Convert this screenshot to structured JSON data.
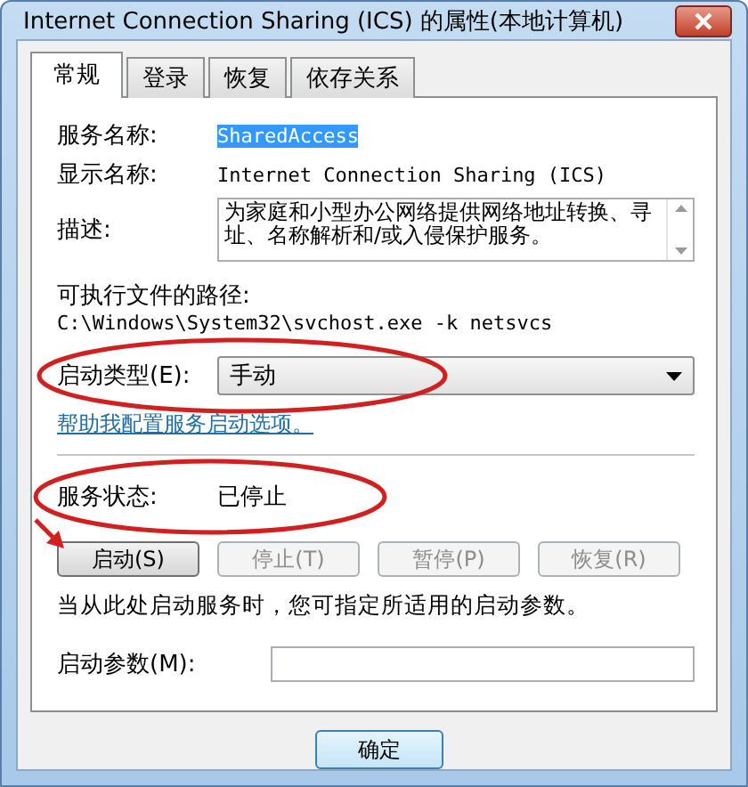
{
  "window": {
    "title": "Internet Connection Sharing (ICS) 的属性(本地计算机)"
  },
  "tabs": [
    {
      "label": "常规",
      "selected": true
    },
    {
      "label": "登录",
      "selected": false
    },
    {
      "label": "恢复",
      "selected": false
    },
    {
      "label": "依存关系",
      "selected": false
    }
  ],
  "service_name": {
    "label": "服务名称:",
    "value": "SharedAccess",
    "selected": true
  },
  "display_name": {
    "label": "显示名称:",
    "value": "Internet Connection Sharing (ICS)"
  },
  "description": {
    "label": "描述:",
    "value": "为家庭和小型办公网络提供网络地址转换、寻址、名称解析和/或入侵保护服务。"
  },
  "executable_path": {
    "label": "可执行文件的路径:",
    "value": "C:\\Windows\\System32\\svchost.exe -k netsvcs"
  },
  "startup_type": {
    "label": "启动类型(E):",
    "value": "手动"
  },
  "help_link": "帮助我配置服务启动选项。",
  "service_status": {
    "label": "服务状态:",
    "value": "已停止"
  },
  "service_buttons": [
    {
      "label": "启动(S)",
      "disabled": false
    },
    {
      "label": "停止(T)",
      "disabled": true
    },
    {
      "label": "暂停(P)",
      "disabled": true
    },
    {
      "label": "恢复(R)",
      "disabled": true
    }
  ],
  "start_hint": "当从此处启动服务时，您可指定所适用的启动参数。",
  "start_parameters": {
    "label": "启动参数(M):"
  },
  "dialog_buttons": [
    {
      "label": "确定"
    }
  ]
}
